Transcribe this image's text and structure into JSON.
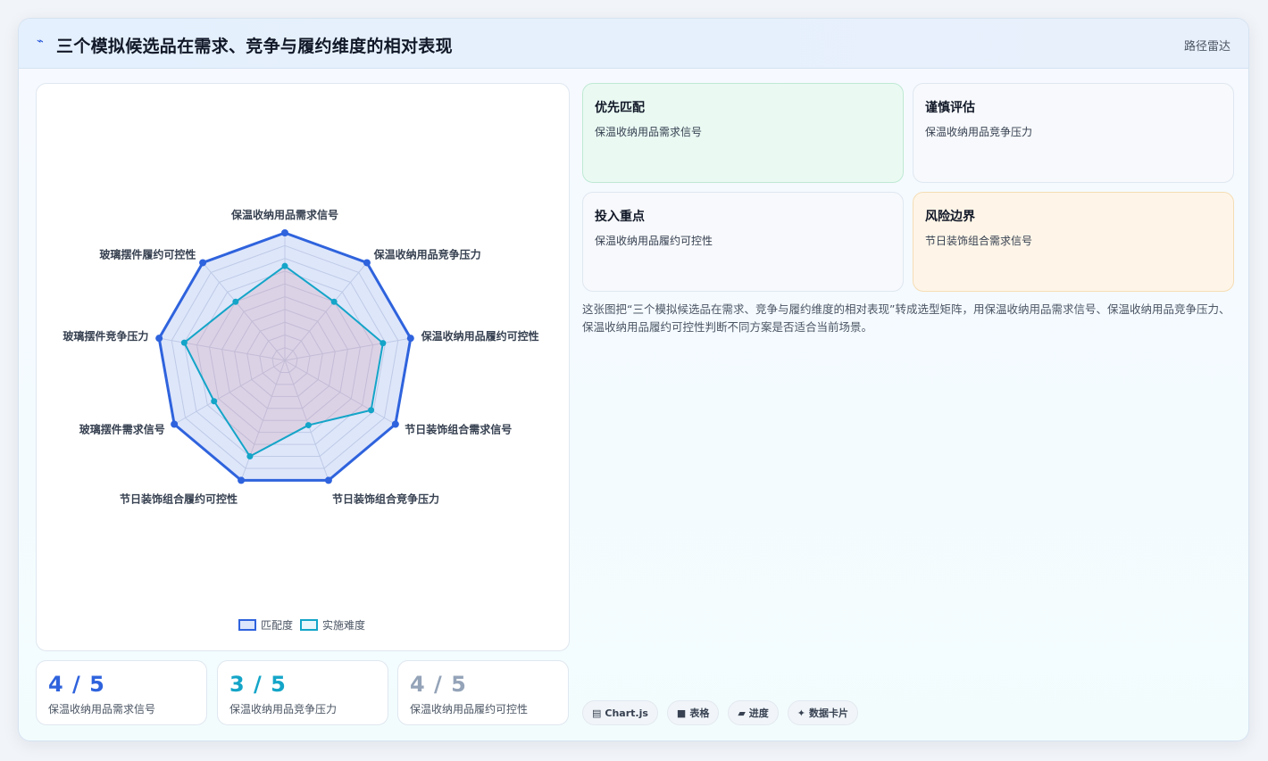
{
  "header": {
    "icon": "pulse-icon",
    "title": "三个模拟候选品在需求、竞争与履约维度的相对表现",
    "tag": "路径雷达"
  },
  "chart_data": {
    "type": "radar",
    "axes": [
      "保温收纳用品需求信号",
      "保温收纳用品竞争压力",
      "保温收纳用品履约可控性",
      "节日装饰组合需求信号",
      "节日装饰组合竞争压力",
      "节日装饰组合履约可控性",
      "玻璃摆件需求信号",
      "玻璃摆件竞争压力",
      "玻璃摆件履约可控性"
    ],
    "range": [
      0,
      5
    ],
    "grid": true,
    "legend_position": "bottom",
    "series": [
      {
        "name": "匹配度",
        "color": "#2f63dd",
        "fill": "rgba(47,99,221,0.16)",
        "values": [
          5,
          5,
          5,
          5,
          5,
          5,
          5,
          5,
          5
        ]
      },
      {
        "name": "实施难度",
        "color": "#14a5c8",
        "fill": "rgba(214,140,160,0.22)",
        "values": [
          3.7,
          3,
          3.9,
          3.9,
          2.7,
          4,
          3.2,
          4,
          3
        ]
      }
    ]
  },
  "stats": [
    {
      "value": "4 / 5",
      "label": "保温收纳用品需求信号",
      "color": "#2f63dd"
    },
    {
      "value": "3 / 5",
      "label": "保温收纳用品竞争压力",
      "color": "#14a5c8"
    },
    {
      "value": "4 / 5",
      "label": "保温收纳用品履约可控性",
      "color": "#94a3b8"
    }
  ],
  "boxes": [
    {
      "title": "优先匹配",
      "body": "保温收纳用品需求信号"
    },
    {
      "title": "谨慎评估",
      "body": "保温收纳用品竞争压力"
    },
    {
      "title": "投入重点",
      "body": "保温收纳用品履约可控性"
    },
    {
      "title": "风险边界",
      "body": "节日装饰组合需求信号"
    }
  ],
  "description": "这张图把“三个模拟候选品在需求、竞争与履约维度的相对表现”转成选型矩阵，用保温收纳用品需求信号、保温收纳用品竞争压力、保温收纳用品履约可控性判断不同方案是否适合当前场景。",
  "chips": [
    {
      "icon": "chart-icon",
      "glyph": "▤",
      "label": "Chart.js"
    },
    {
      "icon": "table-icon",
      "glyph": "■",
      "label": "表格"
    },
    {
      "icon": "progress-icon",
      "glyph": "▰",
      "label": "进度"
    },
    {
      "icon": "card-icon",
      "glyph": "✦",
      "label": "数据卡片"
    }
  ]
}
